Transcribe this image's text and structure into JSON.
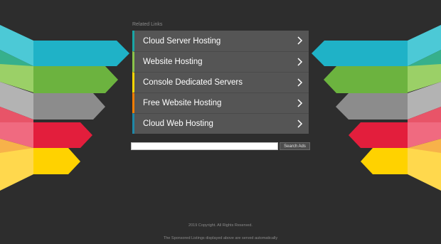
{
  "related_links": {
    "title": "Related Links",
    "items": [
      {
        "label": "Cloud Server Hosting",
        "accent": "#1aa6a6"
      },
      {
        "label": "Website Hosting",
        "accent": "#8bc34a"
      },
      {
        "label": "Console Dedicated Servers",
        "accent": "#ffd600"
      },
      {
        "label": "Free Website Hosting",
        "accent": "#f57c00"
      },
      {
        "label": "Cloud Web Hosting",
        "accent": "#1e88a8"
      }
    ]
  },
  "search": {
    "value": "",
    "button_label": "Search Ads"
  },
  "footer": {
    "copyright": "2019 Copyright. All Rights Reserved.",
    "disclaimer": "The Sponsored Listings displayed above are served automatically"
  },
  "arrow_colors": [
    "#1fb2c7",
    "#2fb58a",
    "#6cb33f",
    "#9aa0a6",
    "#e31e3c",
    "#f5a623",
    "#ffd200"
  ]
}
